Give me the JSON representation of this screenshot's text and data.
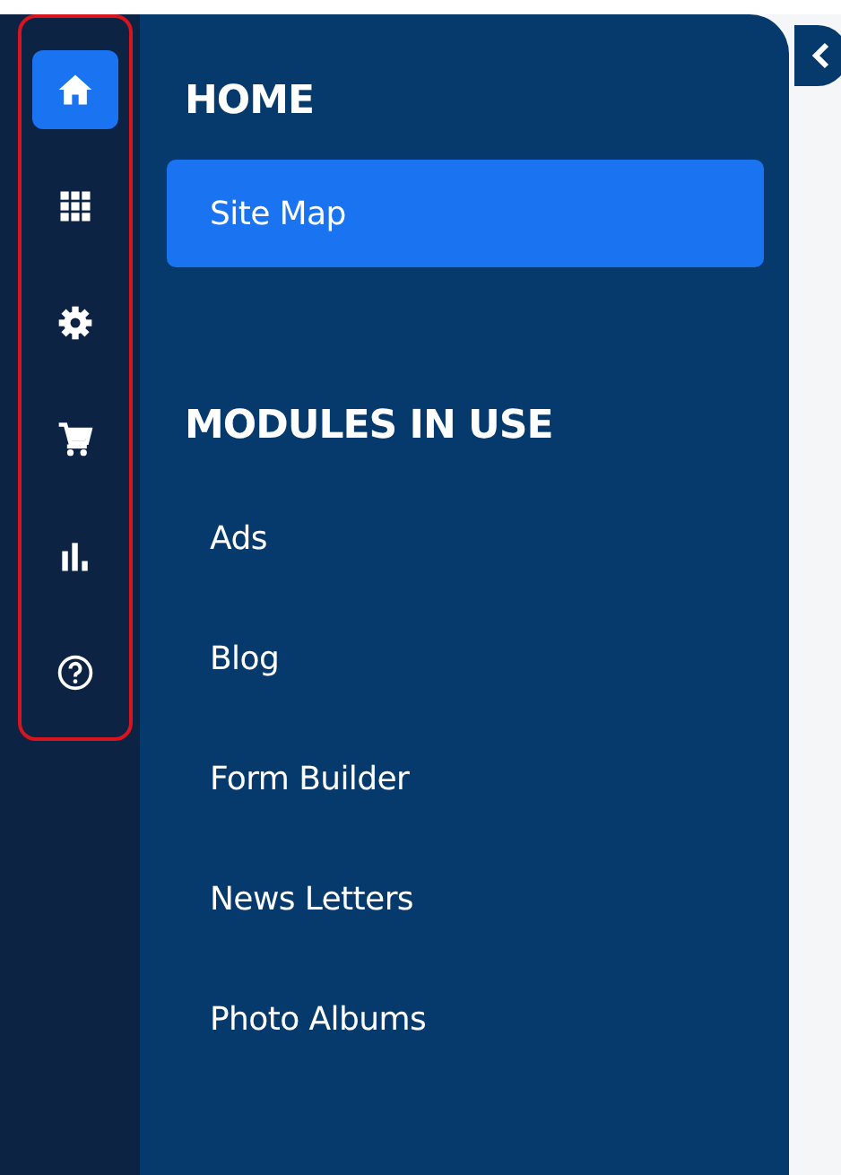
{
  "rail": [
    {
      "kind": "home",
      "selected": true
    },
    {
      "kind": "grid",
      "selected": false
    },
    {
      "kind": "gear",
      "selected": false
    },
    {
      "kind": "cart",
      "selected": false
    },
    {
      "kind": "chart",
      "selected": false
    },
    {
      "kind": "help",
      "selected": false
    }
  ],
  "sections": [
    {
      "heading": "HOME",
      "items": [
        {
          "label": "Site Map",
          "selected": true
        }
      ]
    },
    {
      "heading": "MODULES IN USE",
      "items": [
        {
          "label": "Ads",
          "selected": false
        },
        {
          "label": "Blog",
          "selected": false
        },
        {
          "label": "Form Builder",
          "selected": false
        },
        {
          "label": "News Letters",
          "selected": false
        },
        {
          "label": "Photo Albums",
          "selected": false
        }
      ]
    }
  ]
}
